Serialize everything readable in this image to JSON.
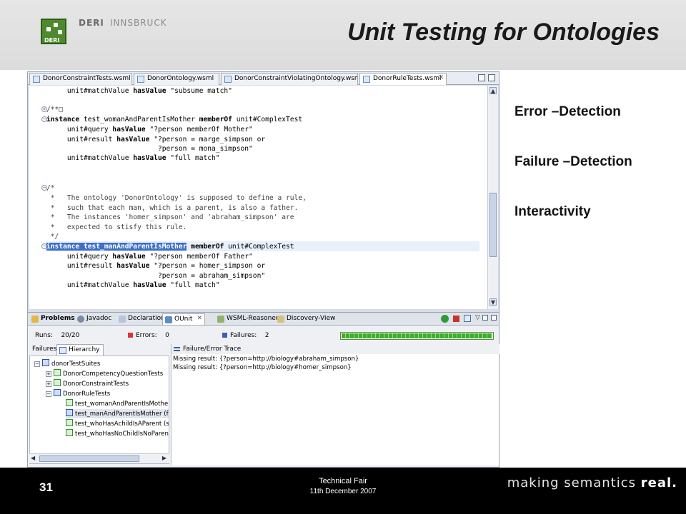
{
  "slide": {
    "title": "Unit Testing for Ontologies",
    "logo": {
      "primary": "DERI",
      "secondary": "INNSBRUCK",
      "mark": "DERI"
    },
    "bullets": [
      "Error –Detection",
      "Failure –Detection",
      "Interactivity"
    ],
    "footer": {
      "page_number": "31",
      "event": "Technical Fair",
      "date": "11th December 2007",
      "tagline_prefix": "making semantics",
      "tagline_emph": "real."
    }
  },
  "editor": {
    "tabs": [
      "DonorConstraintTests.wsml",
      "DonorOntology.wsml",
      "DonorConstraintViolatingOntology.wsml",
      "DonorRuleTests.wsml"
    ],
    "active_tab": "DonorRuleTests.wsml",
    "code": {
      "l1": "     unit#matchValue ",
      "l1k": "hasValue",
      "l1s": " \"subsume match\"",
      "l2": "/**□",
      "l3k": "instance",
      "l3": " test_womanAndParentIsMother ",
      "l3k2": "memberOf",
      "l3b": " unit#ComplexTest",
      "l4": "     unit#query ",
      "l4k": "hasValue",
      "l4s": " \"?person memberOf Mother\"",
      "l5": "     unit#result ",
      "l5k": "hasValue",
      "l5s": " \"?person = marge_simpson or",
      "l6": "                           ?person = mona_simpson\"",
      "l7": "     unit#matchValue ",
      "l7k": "hasValue",
      "l7s": " \"full match\"",
      "c1": "/*",
      "c2": " *   The ontology 'DonorOntology' is supposed to define a rule,",
      "c3": " *   such that each man, which is a parent, is also a father.",
      "c4": " *   The instances 'homer_simpson' and 'abraham_simpson' are",
      "c5": " *   expected to stisfy this rule.",
      "c6": " */",
      "s1": "instance test_manAndParentIsMother",
      "s1k": " memberOf",
      "s1b": " unit#ComplexTest",
      "s2": "     unit#query ",
      "s2k": "hasValue",
      "s2s": " \"?person memberOf Father\"",
      "s3": "     unit#result ",
      "s3k": "hasValue",
      "s3s": " \"?person = homer_simpson or",
      "s4": "                           ?person = abraham_simpson\"",
      "s5": "     unit#matchValue ",
      "s5k": "hasValue",
      "s5s": " \"full match\""
    }
  },
  "panel": {
    "tabs": [
      "Problems",
      "Javadoc",
      "Declaration",
      "OUnit",
      "WSML-Reasoner",
      "Discovery-View"
    ],
    "active_tab": "OUnit",
    "runs_label": "Runs:",
    "runs_value": "20/20",
    "errors_label": "Errors:",
    "errors_value": "0",
    "failures_label": "Failures:",
    "failures_value": "2",
    "progress": 1.0,
    "subtabs": [
      "Failures",
      "Hierarchy"
    ],
    "active_subtab": "Hierarchy",
    "tree": {
      "root": "donorTestSuites",
      "suite1": "DonorCompetencyQuestionTests",
      "suite2": "DonorConstraintTests",
      "suite3": "DonorRuleTests",
      "t1": "test_womanAndParentIsMother (",
      "t2": "test_manAndParentIsMother (ful",
      "t3": "test_whoHasAchildIsAParent (su",
      "t4": "test_whoHasNoChildIsNoParent ("
    },
    "trace_title": "Failure/Error Trace",
    "trace_lines": [
      "Missing result: {?person=http://biology#abraham_simpson}",
      "Missing result: {?person=http://biology#homer_simpson}"
    ]
  }
}
